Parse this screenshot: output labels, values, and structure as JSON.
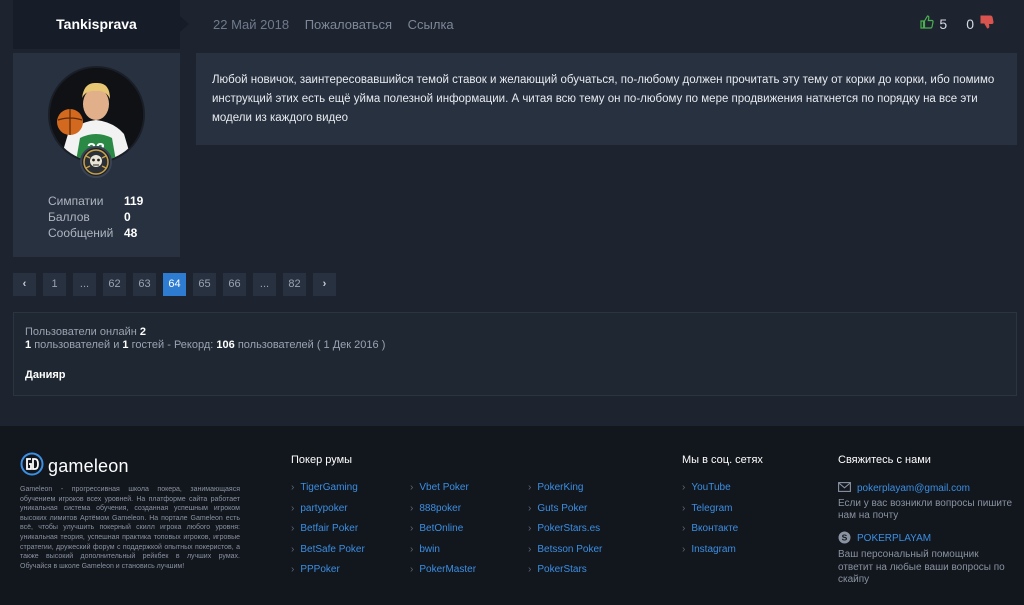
{
  "post": {
    "author": "Tankisprava",
    "date": "22 Май 2018",
    "report_label": "Пожаловаться",
    "link_label": "Ссылка",
    "likes": "5",
    "dislikes": "0",
    "text": "Любой новичок, заинтересовавшийся темой ставок и желающий обучаться, по-любому должен прочитать эту тему от корки до корки, ибо помимо инструкций этих есть ещё уйма полезной информации. А читая всю тему он по-любому по мере продвижения наткнется по порядку на все эти модели из каждого видео",
    "stats": [
      {
        "label": "Симпатии",
        "value": "119"
      },
      {
        "label": "Баллов",
        "value": "0"
      },
      {
        "label": "Сообщений",
        "value": "48"
      }
    ]
  },
  "pagination": {
    "prev": "‹",
    "next": "›",
    "pages": [
      "1",
      "...",
      "62",
      "63",
      "64",
      "65",
      "66",
      "...",
      "82"
    ],
    "current": "64"
  },
  "online": {
    "title_prefix": "Пользователи онлайн",
    "title_count": "2",
    "members": "1",
    "members_label": "пользователей и",
    "guests": "1",
    "guests_label": "гостей - Рекорд:",
    "record": "106",
    "record_label": "пользователей ( 1 Дек 2016 )",
    "user": "Данияр"
  },
  "footer": {
    "logo_text": "gameleon",
    "about": "Gameleon - прогрессивная школа покера, занимающаяся обучением игроков всех уровней. На платформе сайта работает уникальная система обучения, созданная успешным игроком высоких лимитов Артёмом Gameleon. На портале Gameleon есть всё, чтобы улучшить покерный скилл игрока любого уровня: уникальная теория, успешная практика топовых игроков, игровые стратегии, дружеский форум с поддержкой опытных покеристов, а также высокий дополнительный рейкбек в лучших румах. Обучайся в школе Gameleon и становись лучшим!",
    "rooms_title": "Покер румы",
    "rooms_col1": [
      "TigerGaming",
      "partypoker",
      "Betfair Poker",
      "BetSafe Poker",
      "PPPoker"
    ],
    "rooms_col2": [
      "Vbet Poker",
      "888poker",
      "BetOnline",
      "bwin",
      "PokerMaster"
    ],
    "rooms_col3": [
      "PokerKing",
      "Guts Poker",
      "PokerStars.es",
      "Betsson Poker",
      "PokerStars"
    ],
    "social_title": "Мы в соц. сетях",
    "social": [
      "YouTube",
      "Telegram",
      "Вконтакте",
      "Instagram"
    ],
    "contact_title": "Свяжитесь с нами",
    "email": "pokerplayam@gmail.com",
    "email_desc": "Если у вас возникли вопросы пишите нам на почту",
    "skype": "POKERPLAYAM",
    "skype_desc": "Ваш персональный помощник ответит на любые ваши вопросы по скайпу"
  },
  "colors": {
    "accent": "#2e7cd2",
    "link": "#3b8fe4",
    "like": "#4caf50",
    "dislike": "#d9534f"
  }
}
